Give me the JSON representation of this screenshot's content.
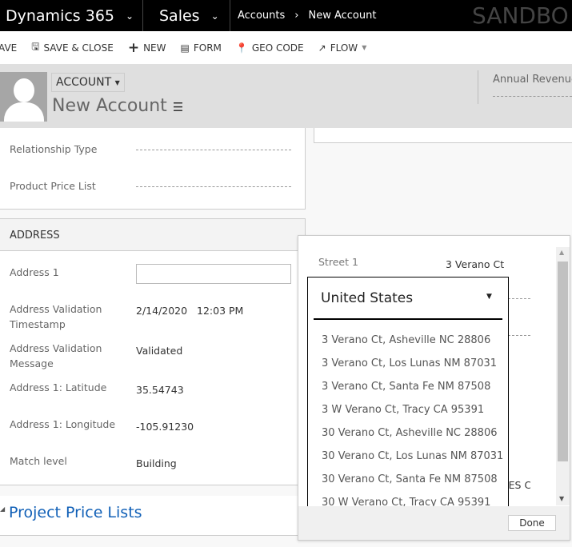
{
  "topbar": {
    "app": "Dynamics 365",
    "module": "Sales",
    "breadcrumb": [
      "Accounts",
      "New Account"
    ],
    "watermark": "SANDBO"
  },
  "commands": [
    {
      "label": "AVE",
      "icon": "save-icon"
    },
    {
      "label": "SAVE & CLOSE",
      "icon": "save-close-icon"
    },
    {
      "label": "NEW",
      "icon": "plus-icon"
    },
    {
      "label": "FORM",
      "icon": "form-icon"
    },
    {
      "label": "GEO CODE",
      "icon": "map-pin-icon"
    },
    {
      "label": "FLOW",
      "icon": "flow-icon"
    }
  ],
  "header": {
    "entity": "ACCOUNT",
    "title": "New Account",
    "annual_revenue_label": "Annual Revenue"
  },
  "fields_top": [
    {
      "label": "Relationship Type"
    },
    {
      "label": "Product Price List"
    }
  ],
  "address": {
    "section": "ADDRESS",
    "fields": [
      {
        "label": "Address 1",
        "value": ""
      },
      {
        "label": "Address Validation Timestamp",
        "value": "2/14/2020   12:03 PM"
      },
      {
        "label": "Address Validation Message",
        "value": "Validated"
      },
      {
        "label": "Address 1: Latitude",
        "value": "35.54743"
      },
      {
        "label": "Address 1: Longitude",
        "value": "-105.91230"
      },
      {
        "label": "Match level",
        "value": "Building"
      }
    ]
  },
  "project_price_lists": "Project Price Lists",
  "popup": {
    "street_label": "Street 1",
    "street_value": "3 Verano Ct",
    "country": "United States",
    "behind_text": "TES C",
    "done": "Done",
    "suggestions": [
      "3 Verano Ct, Asheville NC 28806",
      "3 Verano Ct, Los Lunas NM 87031",
      "3 Verano Ct, Santa Fe NM 87508",
      "3 W Verano Ct, Tracy CA 95391",
      "30 Verano Ct, Asheville NC 28806",
      "30 Verano Ct, Los Lunas NM 87031",
      "30 Verano Ct, Santa Fe NM 87508",
      "30 W Verano Ct, Tracy CA 95391"
    ]
  }
}
